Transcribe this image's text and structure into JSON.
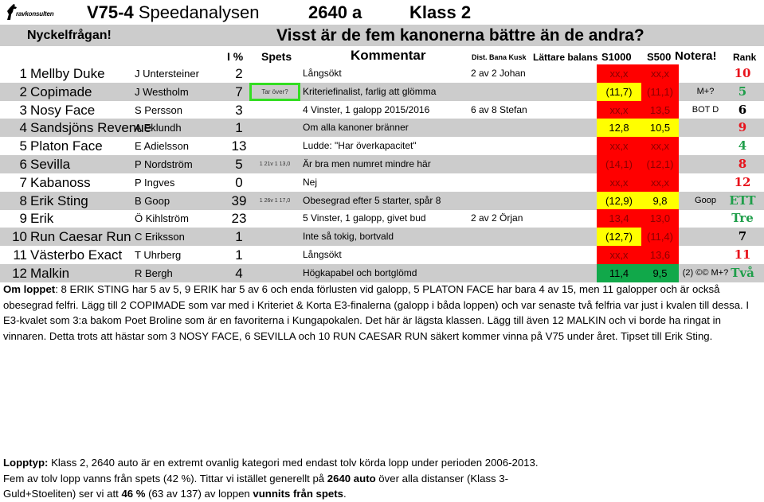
{
  "header": {
    "logo_text": "ravkonsulten",
    "title_bold": "V75-4",
    "title_rest": " Speedanalysen",
    "distance": "2640 a",
    "class": "Klass 2",
    "key_label": "Nyckelfrågan!",
    "key_question": "Visst är de fem kanonerna bättre än de andra?"
  },
  "columns": {
    "ipct": "I %",
    "spets": "Spets",
    "kommentar": "Kommentar",
    "dist": "Dist. Bana Kusk",
    "lattare": "Lättare balans",
    "s1000": "S1000",
    "s500": "S500",
    "notera": "Notera!",
    "rank": "Rank"
  },
  "colors": {
    "red": "#ff0000",
    "yellow": "#ffff00",
    "green": "#11a84a",
    "rank_red": "#e8121b",
    "rank_green": "#1f9e4a",
    "rank_black": "#000000",
    "highlight_border": "#33dd22",
    "row_alt": "#cccccc"
  },
  "rows": [
    {
      "num": "1",
      "name": "Mellby Duke",
      "driver": "J Untersteiner",
      "pct": "2",
      "spets": "",
      "komm": "Långsökt",
      "dist": "2 av 2 Johan",
      "s1000": "xx,x",
      "s1000_color": "red",
      "s500": "xx,x",
      "s500_color": "red",
      "notera": "",
      "rank": "10",
      "rank_color": "red"
    },
    {
      "num": "2",
      "name": "Copimade",
      "driver": "J Westholm",
      "pct": "7",
      "spets": "Tar över?",
      "spets_box": true,
      "komm": "Kriteriefinalist, farlig att glömma",
      "dist": "",
      "s1000": "(11,7)",
      "s1000_color": "yellow",
      "s500": "(11,1)",
      "s500_color": "red",
      "notera": "M+?",
      "rank": "5",
      "rank_color": "green"
    },
    {
      "num": "3",
      "name": "Nosy Face",
      "driver": "S Persson",
      "pct": "3",
      "spets": "",
      "komm": "4 Vinster, 1 galopp 2015/2016",
      "dist": "6 av 8 Stefan",
      "s1000": "xx,x",
      "s1000_color": "red",
      "s500": "13,5",
      "s500_color": "red",
      "notera": "BOT D",
      "rank": "6",
      "rank_color": "black"
    },
    {
      "num": "4",
      "name": "Sandsjöns Revenue",
      "driver": "A Eklundh",
      "pct": "1",
      "spets": "",
      "komm": "Om alla kanoner bränner",
      "dist": "",
      "s1000": "12,8",
      "s1000_color": "yellow",
      "s500": "10,5",
      "s500_color": "yellow",
      "notera": "",
      "rank": "9",
      "rank_color": "red"
    },
    {
      "num": "5",
      "name": "Platon Face",
      "driver": "E Adielsson",
      "pct": "13",
      "spets": "",
      "komm": "Ludde: \"Har överkapacitet\"",
      "dist": "",
      "s1000": "xx,x",
      "s1000_color": "red",
      "s500": "xx,x",
      "s500_color": "red",
      "notera": "",
      "rank": "4",
      "rank_color": "green"
    },
    {
      "num": "6",
      "name": "Sevilla",
      "driver": "P Nordström",
      "pct": "5",
      "spets": "1 21v 1 13,0",
      "komm": "Är bra men numret mindre här",
      "dist": "",
      "s1000": "(14,1)",
      "s1000_color": "red",
      "s500": "(12,1)",
      "s500_color": "red",
      "notera": "",
      "rank": "8",
      "rank_color": "red"
    },
    {
      "num": "7",
      "name": "Kabanoss",
      "driver": "P Ingves",
      "pct": "0",
      "spets": "",
      "komm": "Nej",
      "dist": "",
      "s1000": "xx,x",
      "s1000_color": "red",
      "s500": "xx,x",
      "s500_color": "red",
      "notera": "",
      "rank": "12",
      "rank_color": "red"
    },
    {
      "num": "8",
      "name": "Erik Sting",
      "driver": "B Goop",
      "pct": "39",
      "spets": "1 26v 1 17,0",
      "komm": "Obesegrad efter 5 starter, spår 8",
      "dist": "",
      "s1000": "(12,9)",
      "s1000_color": "yellow",
      "s500": "9,8",
      "s500_color": "yellow",
      "notera": "Goop",
      "rank": "ETT",
      "rank_color": "green"
    },
    {
      "num": "9",
      "name": "Erik",
      "driver": "Ö Kihlström",
      "pct": "23",
      "spets": "",
      "komm": "5 Vinster, 1 galopp, givet bud",
      "dist": "2 av 2 Örjan",
      "s1000": "13,4",
      "s1000_color": "red",
      "s500": "13,0",
      "s500_color": "red",
      "notera": "",
      "rank": "Tre",
      "rank_color": "green"
    },
    {
      "num": "10",
      "name": "Run Caesar Run",
      "driver": "C Eriksson",
      "pct": "1",
      "spets": "",
      "komm": "Inte så tokig, bortvald",
      "dist": "",
      "s1000": "(12,7)",
      "s1000_color": "yellow",
      "s500": "(11,4)",
      "s500_color": "red",
      "notera": "",
      "rank": "7",
      "rank_color": "black"
    },
    {
      "num": "11",
      "name": "Västerbo Exact",
      "driver": "T Uhrberg",
      "pct": "1",
      "spets": "",
      "komm": "Långsökt",
      "dist": "",
      "s1000": "xx,x",
      "s1000_color": "red",
      "s500": "13,6",
      "s500_color": "red",
      "notera": "",
      "rank": "11",
      "rank_color": "red"
    },
    {
      "num": "12",
      "name": "Malkin",
      "driver": "R Bergh",
      "pct": "4",
      "spets": "",
      "komm": "Högkapabel och bortglömd",
      "dist": "",
      "s1000": "11,4",
      "s1000_color": "green",
      "s500": "9,5",
      "s500_color": "green",
      "notera": "(2) ©© M+?",
      "rank": "Två",
      "rank_color": "green"
    }
  ],
  "about_race": {
    "label": "Om loppet",
    "text": ": 8 ERIK STING har 5 av 5, 9 ERIK har 5 av 6 och enda förlusten vid galopp, 5 PLATON FACE har bara 4 av 15, men 11 galopper och är också obesegrad felfri. Lägg till 2 COPIMADE som var med i Kriteriet & Korta E3-finalerna (galopp i båda loppen) och var senaste två felfria var just i kvalen till dessa. I E3-kvalet som 3:a bakom Poet Broline som är en favoriterna i Kungapokalen. Det här är lägsta klassen. Lägg till även 12 MALKIN och vi borde ha ringat in vinnaren. Detta trots att hästar som 3 NOSY FACE, 6 SEVILLA och 10 RUN CAESAR RUN säkert kommer vinna på V75 under året. Tipset till Erik Sting."
  },
  "race_type": {
    "label": "Lopptyp:",
    "t1": " Klass 2, 2640 auto är en extremt ovanlig kategori med endast tolv körda lopp under perioden 2006-2013.",
    "t2": "Fem av tolv lopp vanns från spets (42 %). Tittar vi istället generellt på ",
    "b1": "2640 auto",
    "t3": " över alla distanser (Klass 3-",
    "t4": "Guld+Stoeliten) ser vi att ",
    "b2": "46 %",
    "t5": " (63 av 137) av loppen ",
    "b3": "vunnits från spets",
    "t6": "."
  }
}
